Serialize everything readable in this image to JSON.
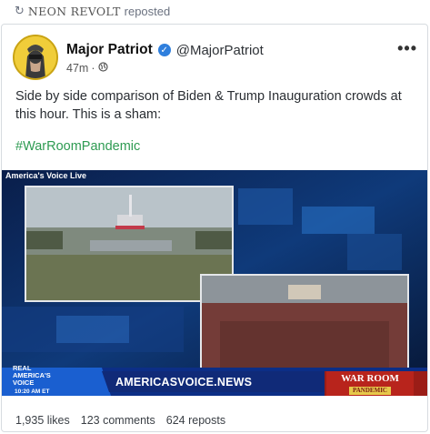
{
  "repost": {
    "reposter": "NEON REVOLT",
    "suffix": "reposted",
    "icon": "repost-icon"
  },
  "post": {
    "author_name": "Major Patriot",
    "verified": true,
    "handle": "@MajorPatriot",
    "time_ago": "47m",
    "separator": "·",
    "visibility_icon": "globe-icon",
    "text": "Side by side comparison of Biden & Trump Inauguration crowds at this hour. This is a sham:",
    "hashtag": "#WarRoomPandemic"
  },
  "media": {
    "caption": "America's Voice Live",
    "brand": "AMERICASVOICE.NEWS",
    "live_logo_lines": [
      "REAL",
      "AMERICA'S",
      "VOICE"
    ],
    "live_time": "10:20 AM ET",
    "warroom_title": "WAR ROOM",
    "warroom_subtitle": "PANDEMIC"
  },
  "stats": {
    "likes": "1,935 likes",
    "comments": "123 comments",
    "reposts": "624 reposts"
  },
  "colors": {
    "hashtag": "#2e9b52",
    "verified": "#2f7fdd",
    "warroom": "#b8241c"
  }
}
